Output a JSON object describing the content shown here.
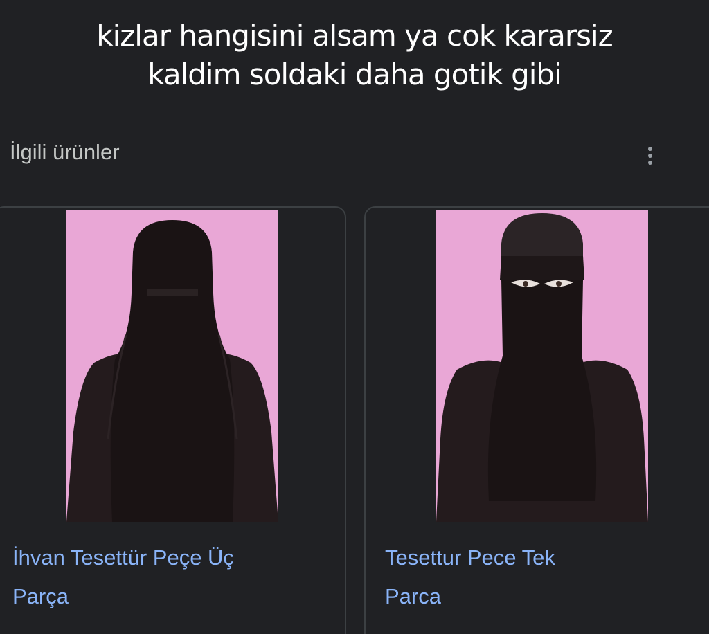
{
  "caption": {
    "line1": "kizlar hangisini alsam ya cok kararsiz",
    "line2": "kaldim soldaki daha gotik gibi"
  },
  "section": {
    "title": "İlgili ürünler",
    "more_icon": "more-vert-icon"
  },
  "products": [
    {
      "name_line1": "İhvan Tesettür Peçe Üç",
      "name_line2": "Parça"
    },
    {
      "name_line1": "Tesettur Pece Tek",
      "name_line2": "Parca"
    }
  ],
  "colors": {
    "background": "#202124",
    "link": "#8ab4f8",
    "photo_background": "#e9a7d6",
    "garment": "#1a1314"
  }
}
